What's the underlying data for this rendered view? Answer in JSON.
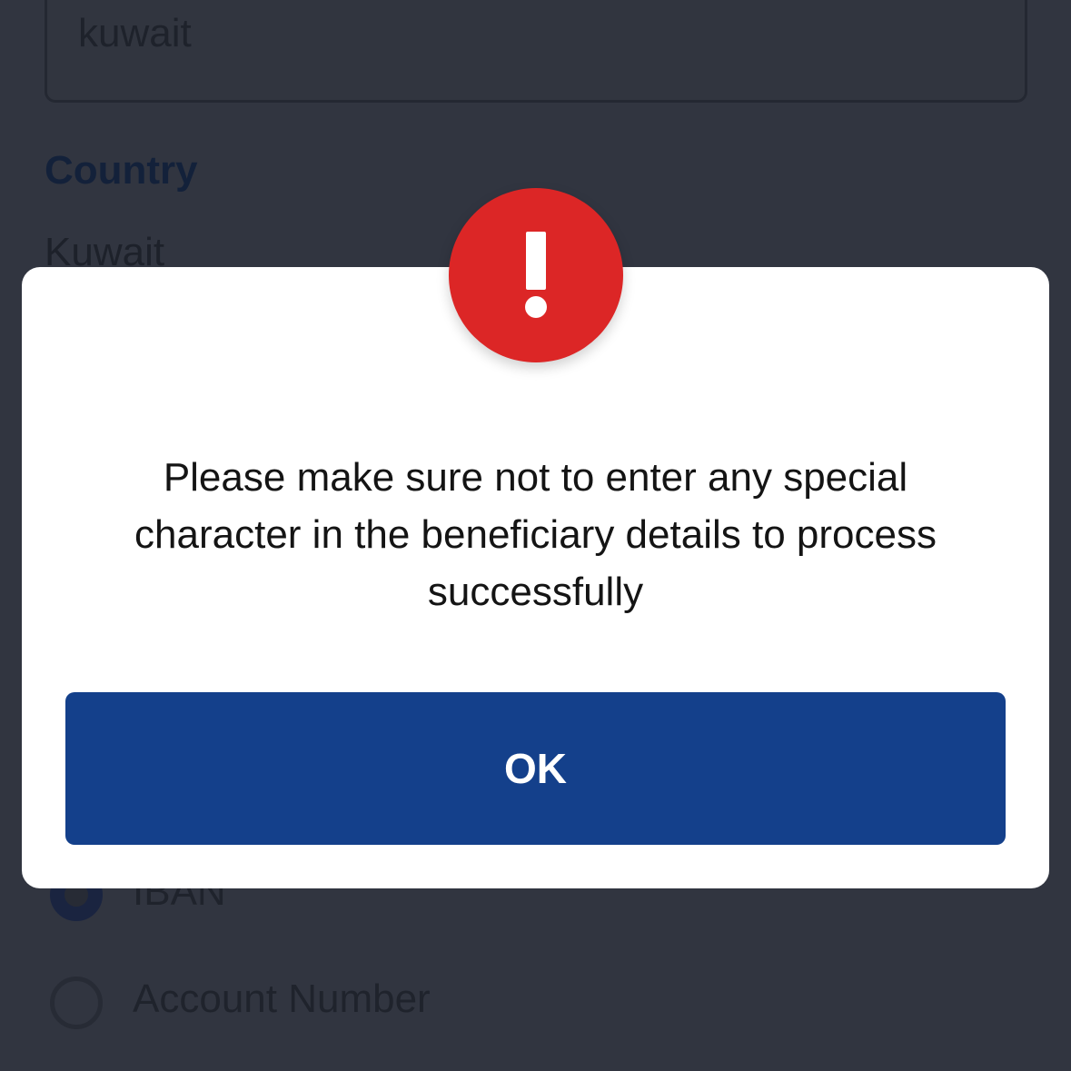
{
  "background": {
    "input_value": "kuwait",
    "country_label": "Country",
    "country_value": "Kuwait",
    "radio_options": [
      {
        "label": "IBAN",
        "selected": true
      },
      {
        "label": "Account Number",
        "selected": false
      }
    ]
  },
  "dialog": {
    "icon": "exclamation-icon",
    "message": "Please make sure not to enter any special character in the beneficiary details to process successfully",
    "ok_label": "OK"
  },
  "colors": {
    "overlay": "#313540",
    "alert_red": "#dc2626",
    "primary_button": "#14408b",
    "dialog_background": "#ffffff"
  }
}
